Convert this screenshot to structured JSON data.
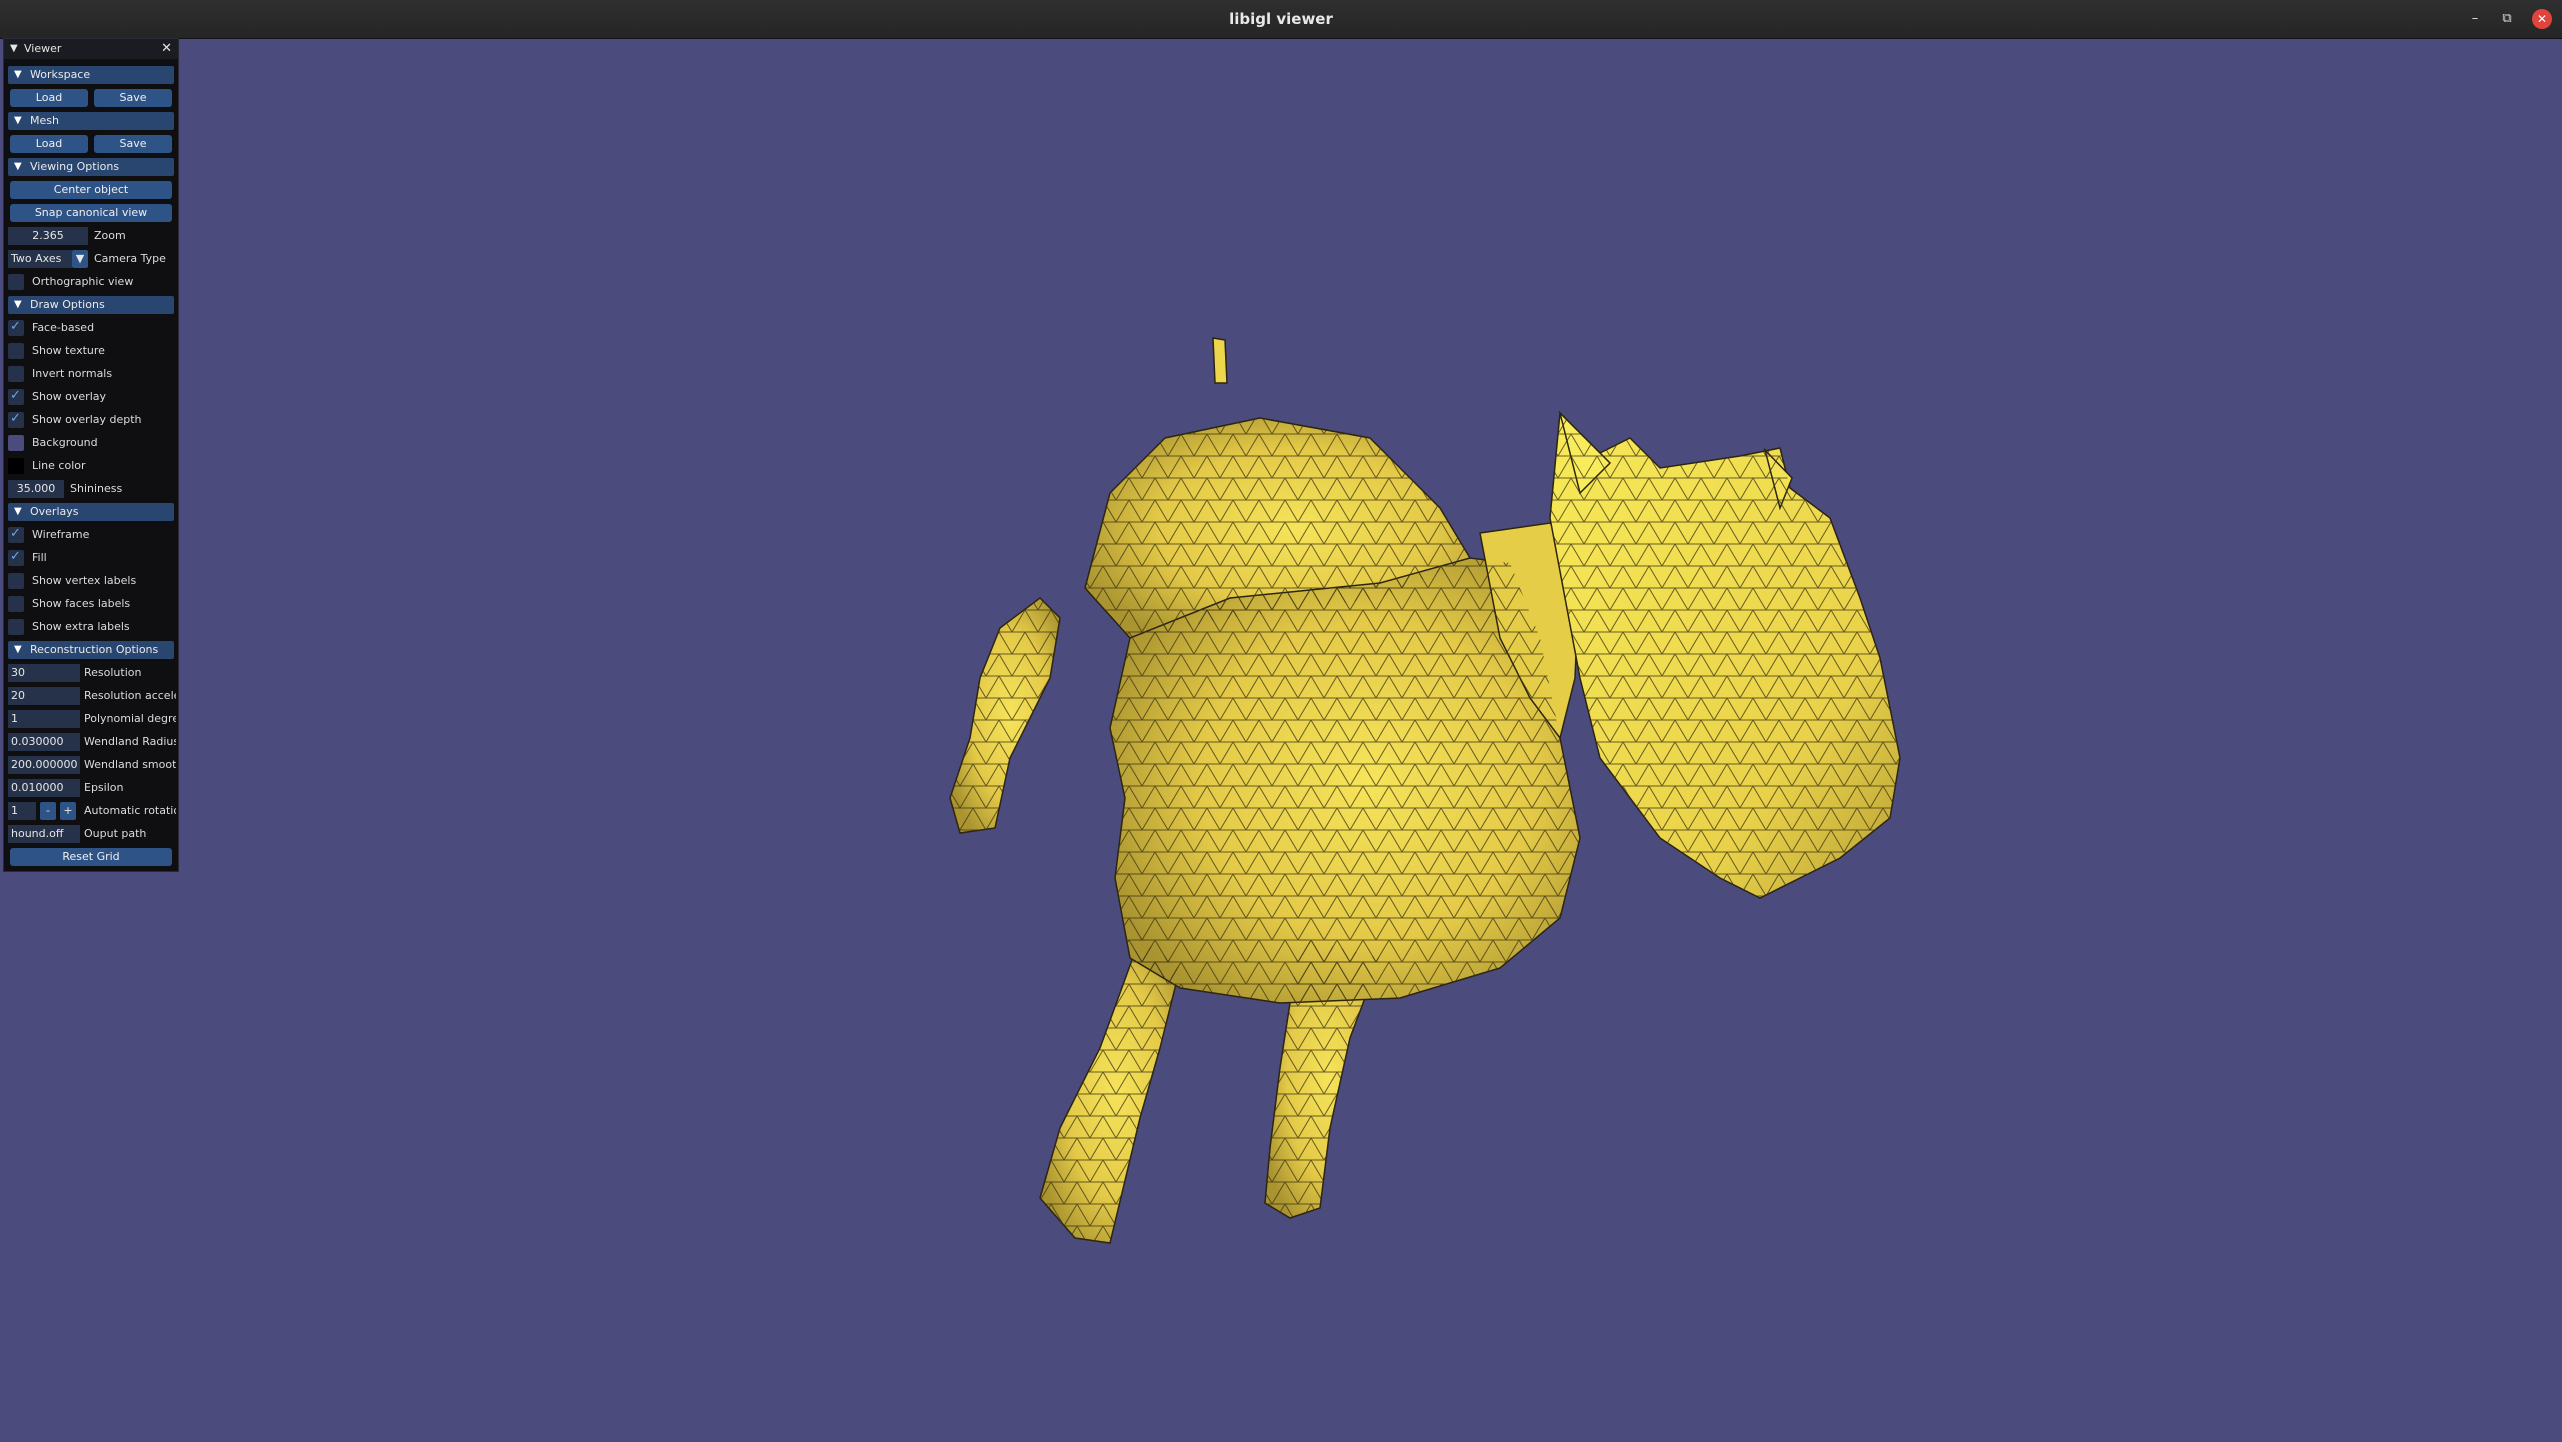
{
  "window": {
    "title": "libigl viewer",
    "minimize": "–",
    "maximize": "⧉",
    "close": "✕"
  },
  "panel": {
    "title": "Viewer",
    "close_glyph": "✕",
    "sections": {
      "workspace": "Workspace",
      "mesh": "Mesh",
      "viewing": "Viewing Options",
      "draw": "Draw Options",
      "overlays": "Overlays",
      "reconstruction": "Reconstruction Options"
    },
    "buttons": {
      "load": "Load",
      "save": "Save",
      "center_object": "Center object",
      "snap_canonical": "Snap canonical view",
      "reset_grid": "Reset Grid",
      "minus": "-",
      "plus": "+"
    },
    "zoom": {
      "value": "2.365",
      "label": "Zoom"
    },
    "camera": {
      "value": "Two Axes",
      "label": "Camera Type"
    },
    "orthographic": {
      "label": "Orthographic view",
      "checked": false
    },
    "draw_options": [
      {
        "label": "Face-based",
        "checked": true
      },
      {
        "label": "Show texture",
        "checked": false
      },
      {
        "label": "Invert normals",
        "checked": false
      },
      {
        "label": "Show overlay",
        "checked": true
      },
      {
        "label": "Show overlay depth",
        "checked": true
      }
    ],
    "background": {
      "label": "Background",
      "color": "#4b4b7e"
    },
    "line_color": {
      "label": "Line color",
      "color": "#000000"
    },
    "shininess": {
      "value": "35.000",
      "label": "Shininess"
    },
    "overlays": [
      {
        "label": "Wireframe",
        "checked": true
      },
      {
        "label": "Fill",
        "checked": true
      },
      {
        "label": "Show vertex labels",
        "checked": false
      },
      {
        "label": "Show faces labels",
        "checked": false
      },
      {
        "label": "Show extra labels",
        "checked": false
      }
    ],
    "reconstruction": {
      "resolution": {
        "value": "30",
        "label": "Resolution"
      },
      "resolution_accel": {
        "value": "20",
        "label": "Resolution acceler"
      },
      "poly_degree": {
        "value": "1",
        "label": "Polynomial degree"
      },
      "wendland_radius": {
        "value": "0.030000",
        "label": "Wendland Radius"
      },
      "wendland_smooth": {
        "value": "200.000000",
        "label": "Wendland smooth"
      },
      "epsilon": {
        "value": "0.010000",
        "label": "Epsilon"
      },
      "auto_rotation": {
        "value": "1",
        "label": "Automatic rotatior"
      },
      "output_path": {
        "value": "hound.off",
        "label": "Ouput path"
      }
    }
  },
  "viewport": {
    "mesh_color": "#e8cf4a",
    "background": "#4b4b7e"
  }
}
